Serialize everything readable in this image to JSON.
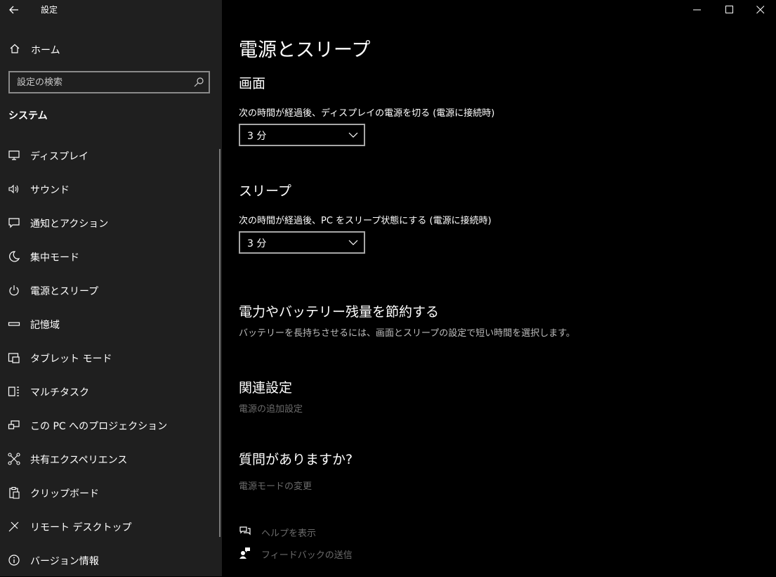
{
  "window": {
    "title": "設定",
    "controls": [
      "minimize-icon",
      "maximize-icon",
      "close-icon"
    ]
  },
  "sidebar": {
    "home_label": "ホーム",
    "search_placeholder": "設定の検索",
    "section_title": "システム",
    "items": [
      {
        "label": "ディスプレイ",
        "icon": "display-icon"
      },
      {
        "label": "サウンド",
        "icon": "speaker-icon"
      },
      {
        "label": "通知とアクション",
        "icon": "notification-icon"
      },
      {
        "label": "集中モード",
        "icon": "moon-icon"
      },
      {
        "label": "電源とスリープ",
        "icon": "power-icon"
      },
      {
        "label": "記憶域",
        "icon": "storage-icon"
      },
      {
        "label": "タブレット モード",
        "icon": "tablet-icon"
      },
      {
        "label": "マルチタスク",
        "icon": "multitask-icon"
      },
      {
        "label": "この PC へのプロジェクション",
        "icon": "projection-icon"
      },
      {
        "label": "共有エクスペリエンス",
        "icon": "share-icon"
      },
      {
        "label": "クリップボード",
        "icon": "clipboard-icon"
      },
      {
        "label": "リモート デスクトップ",
        "icon": "remote-icon"
      },
      {
        "label": "バージョン情報",
        "icon": "info-icon"
      }
    ]
  },
  "main": {
    "page_title": "電源とスリープ",
    "screen": {
      "heading": "画面",
      "label": "次の時間が経過後、ディスプレイの電源を切る (電源に接続時)",
      "value": "3 分"
    },
    "sleep": {
      "heading": "スリープ",
      "label": "次の時間が経過後、PC をスリープ状態にする (電源に接続時)",
      "value": "3 分"
    },
    "save": {
      "heading": "電力やバッテリー残量を節約する",
      "description": "バッテリーを長持ちさせるには、画面とスリープの設定で短い時間を選択します。"
    },
    "related": {
      "heading": "関連設定",
      "link": "電源の追加設定"
    },
    "questions": {
      "heading": "質問がありますか?",
      "link": "電源モードの変更"
    },
    "help": {
      "show_help": "ヘルプを表示",
      "feedback": "フィードバックの送信"
    }
  }
}
